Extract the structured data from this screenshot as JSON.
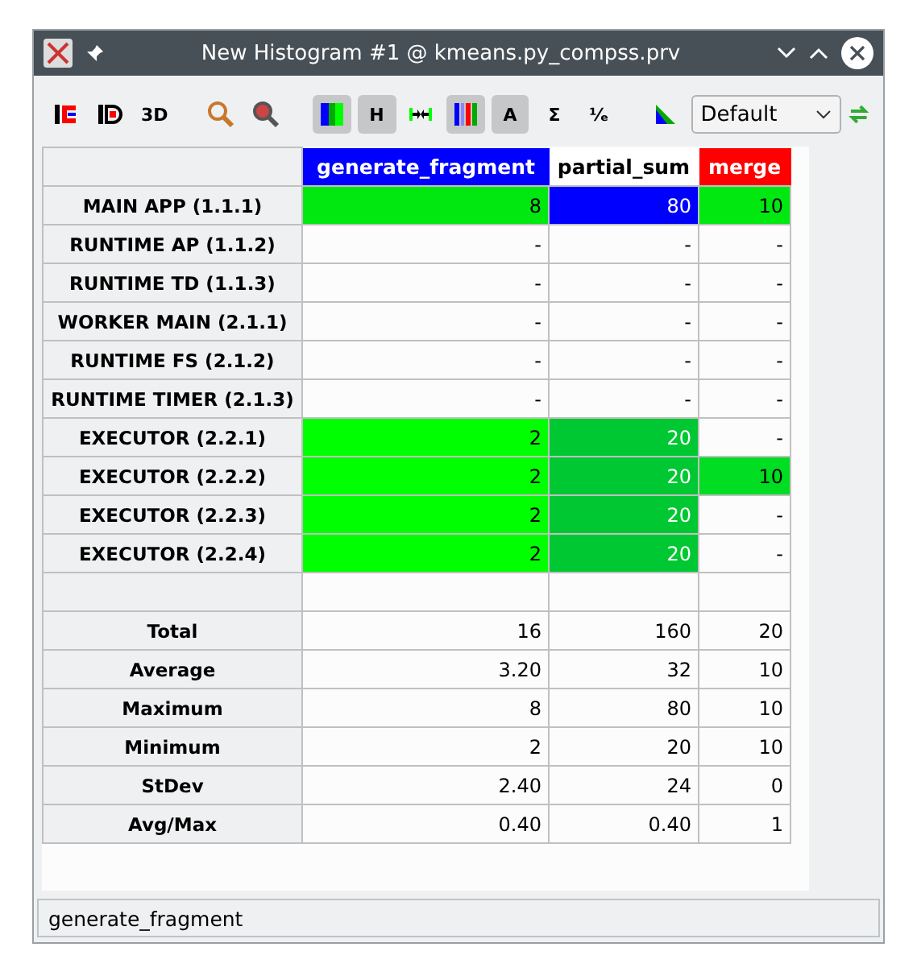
{
  "window": {
    "title": "New Histogram #1 @ kmeans.py_compss.prv"
  },
  "toolbar": [
    {
      "kind": "icon",
      "selected": false
    },
    {
      "kind": "icon",
      "selected": false
    },
    {
      "kind": "text",
      "label": "3D",
      "selected": false
    },
    {
      "kind": "icon",
      "selected": false
    },
    {
      "kind": "icon",
      "selected": false
    },
    {
      "kind": "icon",
      "selected": true
    },
    {
      "kind": "text",
      "label": "H",
      "selected": true
    },
    {
      "kind": "icon",
      "selected": false
    },
    {
      "kind": "icon",
      "selected": true
    },
    {
      "kind": "text",
      "label": "A",
      "selected": true
    },
    {
      "kind": "text",
      "label": "Σ",
      "selected": false
    },
    {
      "kind": "text",
      "label": "⅟ₑ",
      "selected": false
    },
    {
      "kind": "icon",
      "selected": false
    }
  ],
  "semantic_select": {
    "value": "Default"
  },
  "table": {
    "columns": [
      {
        "label": "generate_fragment",
        "color": "#0000ff"
      },
      {
        "label": "partial_sum",
        "color": "#ffffff"
      },
      {
        "label": "merge",
        "color": "#ff0000"
      }
    ],
    "rows": [
      {
        "label": "MAIN APP (1.1.1)",
        "cells": [
          {
            "text": "8",
            "color": "#00e810"
          },
          {
            "text": "80",
            "color": "#0000ff"
          },
          {
            "text": "10",
            "color": "#00e810"
          }
        ]
      },
      {
        "label": "RUNTIME AP (1.1.2)",
        "cells": [
          {
            "text": "-"
          },
          {
            "text": "-"
          },
          {
            "text": "-"
          }
        ]
      },
      {
        "label": "RUNTIME TD (1.1.3)",
        "cells": [
          {
            "text": "-"
          },
          {
            "text": "-"
          },
          {
            "text": "-"
          }
        ]
      },
      {
        "label": "WORKER MAIN (2.1.1)",
        "cells": [
          {
            "text": "-"
          },
          {
            "text": "-"
          },
          {
            "text": "-"
          }
        ]
      },
      {
        "label": "RUNTIME FS (2.1.2)",
        "cells": [
          {
            "text": "-"
          },
          {
            "text": "-"
          },
          {
            "text": "-"
          }
        ]
      },
      {
        "label": "RUNTIME TIMER (2.1.3)",
        "cells": [
          {
            "text": "-"
          },
          {
            "text": "-"
          },
          {
            "text": "-"
          }
        ]
      },
      {
        "label": "EXECUTOR (2.2.1)",
        "cells": [
          {
            "text": "2",
            "color": "#00ff00"
          },
          {
            "text": "20",
            "color": "#00c832"
          },
          {
            "text": "-"
          }
        ]
      },
      {
        "label": "EXECUTOR (2.2.2)",
        "cells": [
          {
            "text": "2",
            "color": "#00ff00"
          },
          {
            "text": "20",
            "color": "#00c832"
          },
          {
            "text": "10",
            "color": "#00dd22"
          }
        ]
      },
      {
        "label": "EXECUTOR (2.2.3)",
        "cells": [
          {
            "text": "2",
            "color": "#00ff00"
          },
          {
            "text": "20",
            "color": "#00c832"
          },
          {
            "text": "-"
          }
        ]
      },
      {
        "label": "EXECUTOR (2.2.4)",
        "cells": [
          {
            "text": "2",
            "color": "#00ff00"
          },
          {
            "text": "20",
            "color": "#00c832"
          },
          {
            "text": "-"
          }
        ]
      }
    ],
    "stats": [
      {
        "label": "Total",
        "cells": [
          "16",
          "160",
          "20"
        ]
      },
      {
        "label": "Average",
        "cells": [
          "3.20",
          "32",
          "10"
        ]
      },
      {
        "label": "Maximum",
        "cells": [
          "8",
          "80",
          "10"
        ]
      },
      {
        "label": "Minimum",
        "cells": [
          "2",
          "20",
          "10"
        ]
      },
      {
        "label": "StDev",
        "cells": [
          "2.40",
          "24",
          "0"
        ]
      },
      {
        "label": "Avg/Max",
        "cells": [
          "0.40",
          "0.40",
          "1"
        ]
      }
    ]
  },
  "status_bar": {
    "text": "generate_fragment"
  }
}
